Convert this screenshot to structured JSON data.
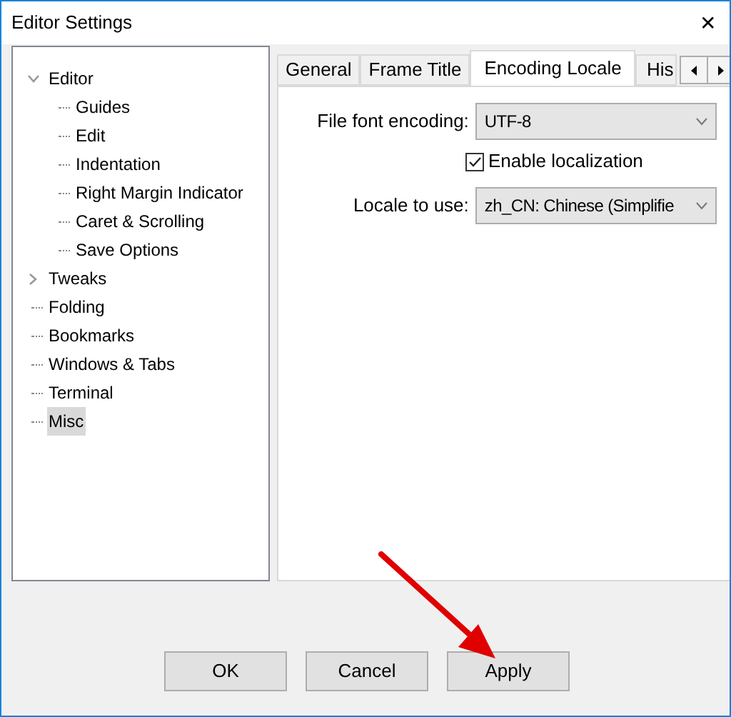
{
  "window": {
    "title": "Editor Settings",
    "close": "✕"
  },
  "tree": [
    {
      "label": "Editor",
      "expanded": true,
      "selected": false,
      "children": [
        {
          "label": "Guides",
          "selected": false
        },
        {
          "label": "Edit",
          "selected": false
        },
        {
          "label": "Indentation",
          "selected": false
        },
        {
          "label": "Right Margin Indicator",
          "selected": false
        },
        {
          "label": "Caret & Scrolling",
          "selected": false
        },
        {
          "label": "Save Options",
          "selected": false
        }
      ]
    },
    {
      "label": "Tweaks",
      "expanded": false,
      "selected": false
    },
    {
      "label": "Folding",
      "selected": false
    },
    {
      "label": "Bookmarks",
      "selected": false
    },
    {
      "label": "Windows & Tabs",
      "selected": false
    },
    {
      "label": "Terminal",
      "selected": false
    },
    {
      "label": "Misc",
      "selected": true
    }
  ],
  "tabs": [
    {
      "label": "General",
      "selected": false
    },
    {
      "label": "Frame Title",
      "selected": false
    },
    {
      "label": "Encoding Locale",
      "selected": true
    },
    {
      "label": "His",
      "selected": false
    }
  ],
  "form": [
    {
      "kind": "select",
      "label": "File font encoding:",
      "value": "UTF-8"
    },
    {
      "kind": "checkbox",
      "label": "Enable localization",
      "checked": true
    },
    {
      "kind": "select",
      "label": "Locale to use:",
      "value": "zh_CN: Chinese (Simplifie"
    }
  ],
  "buttons": [
    "OK",
    "Cancel",
    "Apply"
  ]
}
